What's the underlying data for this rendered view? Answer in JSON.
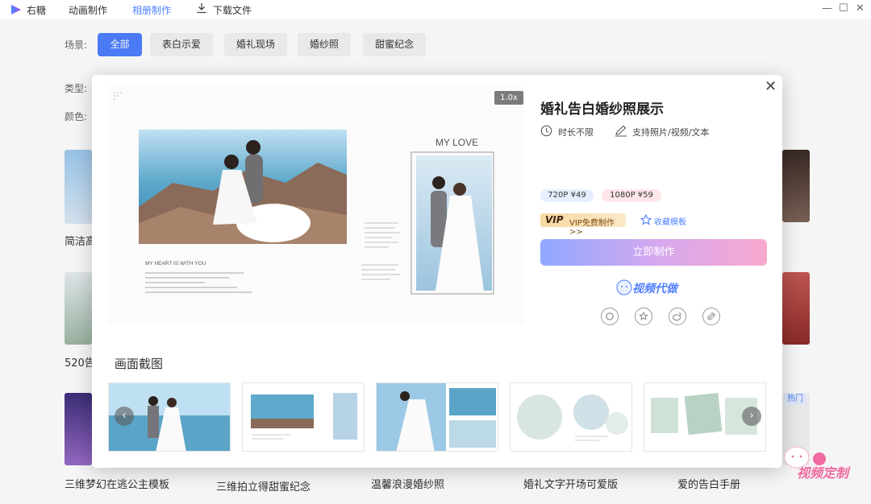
{
  "app": {
    "name": "右糖"
  },
  "nav": [
    {
      "label": "动画制作"
    },
    {
      "label": "相册制作",
      "active": true
    },
    {
      "label": "下载文件"
    }
  ],
  "window_controls": [
    "—",
    "☐",
    "✕"
  ],
  "filters": {
    "scene_label": "场景:",
    "type_label": "类型:",
    "color_label": "颜色:",
    "chips": [
      {
        "label": "全部",
        "active": true
      },
      {
        "label": "表白示爱"
      },
      {
        "label": "婚礼现场"
      },
      {
        "label": "婚纱照"
      },
      {
        "label": "甜蜜纪念"
      }
    ]
  },
  "background_items": [
    {
      "title": "简洁高"
    },
    {
      "title": "520告"
    },
    {
      "title": "三维梦幻在逃公主模板"
    },
    {
      "title": "三维拍立得甜蜜纪念"
    },
    {
      "title": "温馨浪漫婚纱照"
    },
    {
      "title": "婚礼文字开场可爱版"
    },
    {
      "title": "爱的告白手册"
    }
  ],
  "hot_badge": "热门",
  "modal": {
    "speed": "1.0x",
    "title": "婚礼告白婚纱照展示",
    "duration": "时长不限",
    "support": "支持照片/视频/文本",
    "resolutions": [
      {
        "label": "720P  ¥49",
        "color": "#e6efff"
      },
      {
        "label": "1080P  ¥59",
        "color": "#ffe6ea"
      }
    ],
    "vip_label": "VIP",
    "vip_text": "VIP免费制作>>",
    "favorite": "收藏模板",
    "make_button": "立即制作",
    "service_logo": "视频代做",
    "share_icons": [
      "qq-icon",
      "star-icon",
      "weibo-icon",
      "link-icon"
    ],
    "screenshots_title": "画面截图",
    "preview_text": {
      "my_love": "MY LOVE",
      "heart_title": "MY HEART IS WITH YOU"
    }
  },
  "corner_watermark": "视频定制",
  "colors": {
    "accent": "#4f7fff",
    "brand_pink": "#f06aa0"
  }
}
